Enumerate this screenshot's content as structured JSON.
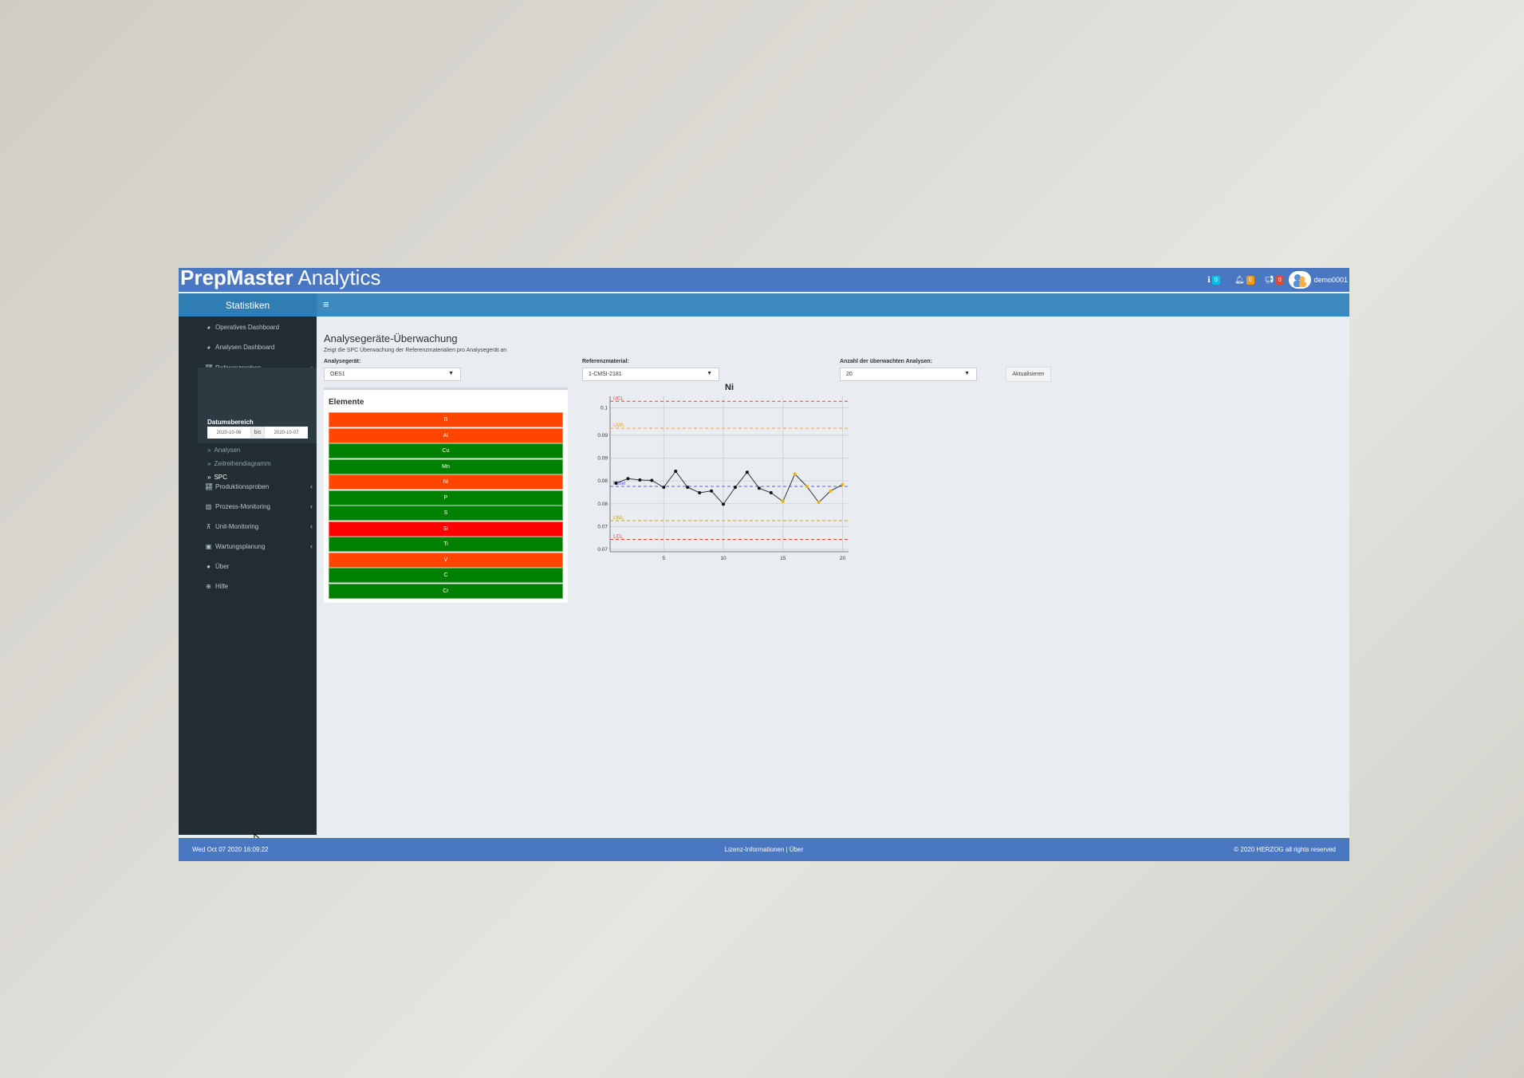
{
  "app": {
    "brand_bold": "PrepMaster",
    "brand_light": " Analytics",
    "header_icons": [
      {
        "icon": "info-icon",
        "count": "0",
        "color": "#00c0ef"
      },
      {
        "icon": "bell-icon",
        "count": "0",
        "color": "#f39c12"
      },
      {
        "icon": "megaphone-icon",
        "count": "0",
        "color": "#dd4b39"
      }
    ],
    "user": "demo0001"
  },
  "sidebar": {
    "title": "Statistiken",
    "items": [
      {
        "label": "Operatives Dashboard",
        "icon": "dashboard-icon"
      },
      {
        "label": "Analysen Dashboard",
        "icon": "dashboard-icon"
      },
      {
        "label": "Referenzproben",
        "icon": "line-chart-icon"
      },
      {
        "label": "Produktionsproben",
        "icon": "line-chart-icon"
      },
      {
        "label": "Prozess-Monitoring",
        "icon": "bar-chart-icon"
      },
      {
        "label": "Unit-Monitoring",
        "icon": "sitemap-icon"
      },
      {
        "label": "Wartungsplanung",
        "icon": "calendar-icon"
      },
      {
        "label": "Über",
        "icon": "info-circle-icon"
      },
      {
        "label": "Hilfe",
        "icon": "life-ring-icon"
      }
    ],
    "date_range": {
      "label": "Datumsbereich",
      "from": "2020-10-06",
      "sep": "bis",
      "to": "2020-10-07"
    },
    "subitems": [
      {
        "label": "Analysen"
      },
      {
        "label": "Zeitreihendiagramm"
      },
      {
        "label": "SPC"
      }
    ]
  },
  "page": {
    "title": "Analysegeräte-Überwachung",
    "description": "Zeigt die SPC Überwachung der Referenzmaterialien pro Analysegerät an",
    "filters": {
      "device_label": "Analysegerät:",
      "device_value": "OES1",
      "ref_label": "Referenzmaterial:",
      "ref_value": "1-CMSI-2181",
      "count_label": "Anzahl der überwachten Analysen:",
      "count_value": "20",
      "button": "Aktualisieren"
    },
    "elements_title": "Elemente",
    "elements": [
      {
        "label": "B",
        "status_color": "#ff4500"
      },
      {
        "label": "Al",
        "status_color": "#ff4500"
      },
      {
        "label": "Cu",
        "status_color": "#008000"
      },
      {
        "label": "Mn",
        "status_color": "#008000"
      },
      {
        "label": "Ni",
        "status_color": "#ff4500"
      },
      {
        "label": "P",
        "status_color": "#008000"
      },
      {
        "label": "S",
        "status_color": "#008000"
      },
      {
        "label": "Si",
        "status_color": "#ff0000"
      },
      {
        "label": "Ti",
        "status_color": "#008000"
      },
      {
        "label": "V",
        "status_color": "#ff4500"
      },
      {
        "label": "C",
        "status_color": "#008000"
      },
      {
        "label": "Cr",
        "status_color": "#008000"
      }
    ]
  },
  "chart_data": {
    "type": "line",
    "title": "Ni",
    "xlabel": "",
    "ylabel": "",
    "xlim": [
      0.5,
      20.5
    ],
    "ylim": [
      0.0685,
      0.1025
    ],
    "x_ticks": [
      5,
      10,
      15,
      20
    ],
    "y_ticks": [
      {
        "value": 0.1,
        "label": "0.1"
      },
      {
        "value": 0.094,
        "label": "0.09"
      },
      {
        "value": 0.089,
        "label": "0.09"
      },
      {
        "value": 0.084,
        "label": "0.08"
      },
      {
        "value": 0.079,
        "label": "0.08"
      },
      {
        "value": 0.074,
        "label": "0.07"
      },
      {
        "value": 0.069,
        "label": "0.07"
      }
    ],
    "grid": true,
    "x": [
      1,
      2,
      3,
      4,
      5,
      6,
      7,
      8,
      9,
      10,
      11,
      12,
      13,
      14,
      15,
      16,
      17,
      18,
      19,
      20
    ],
    "values": [
      0.0835,
      0.0845,
      0.0842,
      0.0841,
      0.0826,
      0.0861,
      0.0826,
      0.0814,
      0.0818,
      0.0789,
      0.0826,
      0.0859,
      0.0824,
      0.0814,
      0.0795,
      0.0855,
      0.0828,
      0.0793,
      0.0818,
      0.0832
    ],
    "point_status": [
      "ok",
      "ok",
      "ok",
      "ok",
      "ok",
      "ok",
      "ok",
      "ok",
      "ok",
      "ok",
      "ok",
      "ok",
      "ok",
      "ok",
      "warn",
      "warn",
      "warn",
      "warn",
      "warn",
      "warn"
    ],
    "limits": [
      {
        "name": "UCL",
        "value": 0.1014,
        "color": "#e8413a"
      },
      {
        "name": "UWL",
        "value": 0.0955,
        "color": "#f0a030"
      },
      {
        "name": "Mittel",
        "value": 0.0828,
        "color": "#6a5adc"
      },
      {
        "name": "LWL",
        "value": 0.0753,
        "color": "#c8a020"
      },
      {
        "name": "LCL",
        "value": 0.0712,
        "color": "#e8413a"
      }
    ],
    "line_color": "#333333",
    "warn_color": "#f0b400"
  },
  "footer": {
    "datetime": "Wed Oct 07 2020 16:09:22",
    "links": "Lizenz-Informationen  |  Über",
    "copyright": "© 2020 HERZOG all rights reserved"
  }
}
